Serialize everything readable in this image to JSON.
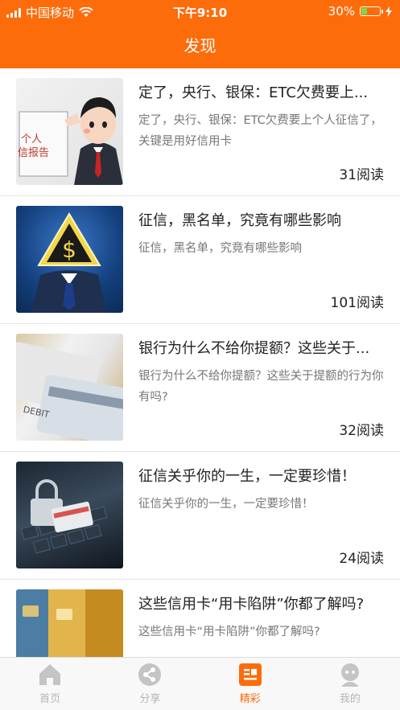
{
  "status_bar": {
    "carrier": "中国移动",
    "time": "下午9:10",
    "battery": "30%",
    "battery_level": 0.3
  },
  "header": {
    "title": "发现"
  },
  "articles": [
    {
      "title": "定了，央行、银保：ETC欠费要上...",
      "desc": "定了，央行、银保：ETC欠费要上个人征信了，关键是用好信用卡",
      "reads": "31阅读",
      "thumb_text": "个人\n信报告"
    },
    {
      "title": "征信，黑名单，究竟有哪些影响",
      "desc": "征信，黑名单，究竟有哪些影响",
      "reads": "101阅读",
      "thumb_text": "$"
    },
    {
      "title": "银行为什么不给你提额？这些关于...",
      "desc": "银行为什么不给你提额？这些关于提额的行为你有吗?",
      "reads": "32阅读",
      "thumb_text": "DEBIT"
    },
    {
      "title": "征信关乎你的一生，一定要珍惜！",
      "desc": "征信关乎你的一生，一定要珍惜！",
      "reads": "24阅读"
    },
    {
      "title": "这些信用卡“用卡陷阱”你都了解吗?",
      "desc": "这些信用卡“用卡陷阱”你都了解吗?",
      "reads": ""
    }
  ],
  "tabs": [
    {
      "label": "首页",
      "icon": "home-icon"
    },
    {
      "label": "分享",
      "icon": "share-icon"
    },
    {
      "label": "精彩",
      "icon": "list-icon",
      "active": true
    },
    {
      "label": "我的",
      "icon": "user-icon"
    }
  ],
  "colors": {
    "accent": "#fd6c0b",
    "battery_fill": "#7ddc3d"
  }
}
